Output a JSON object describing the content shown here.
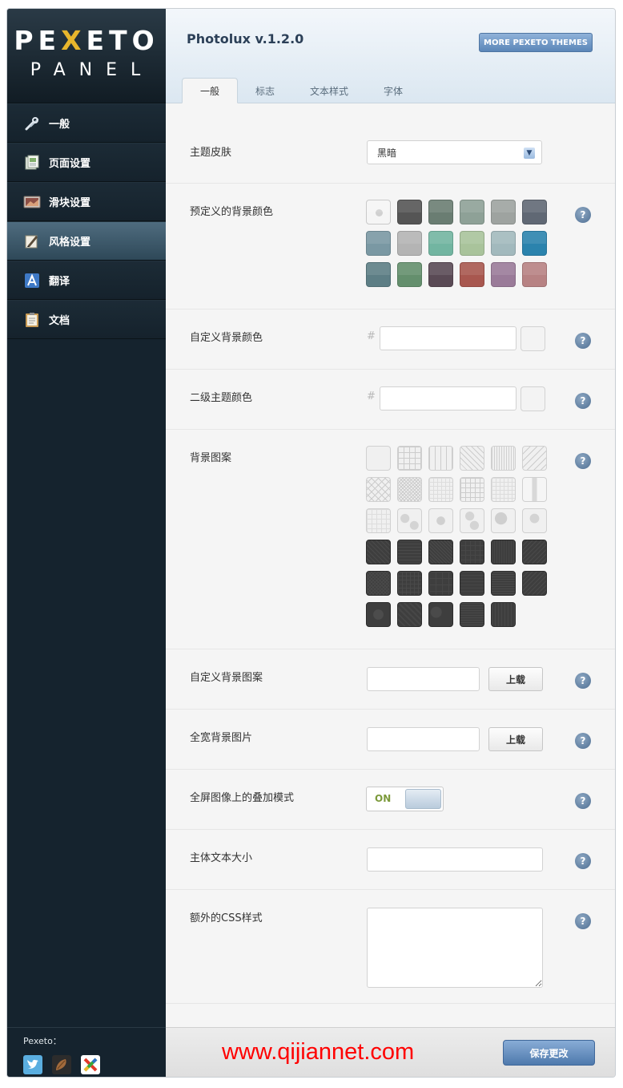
{
  "logo": {
    "word_part1": "PE",
    "word_x": "X",
    "word_part2": "ETO",
    "sub": "PANEL"
  },
  "sidebar": {
    "items": [
      {
        "label": "一般",
        "icon": "tools-icon"
      },
      {
        "label": "页面设置",
        "icon": "pages-icon"
      },
      {
        "label": "滑块设置",
        "icon": "slider-icon"
      },
      {
        "label": "风格设置",
        "icon": "style-icon",
        "active": true
      },
      {
        "label": "翻译",
        "icon": "translate-icon"
      },
      {
        "label": "文档",
        "icon": "document-icon"
      }
    ],
    "social_title": "Pexeto：",
    "social_icons": [
      "twitter-icon",
      "dribbble-icon",
      "pexeto-x-icon"
    ]
  },
  "header": {
    "title": "Photolux v.1.2.0",
    "themes_button": "MORE PEXETO THEMES",
    "tabs": [
      {
        "label": "一般",
        "active": true
      },
      {
        "label": "标志"
      },
      {
        "label": "文本样式"
      },
      {
        "label": "字体"
      }
    ]
  },
  "settings": {
    "theme_skin": {
      "label": "主题皮肤",
      "value": "黑暗"
    },
    "predefined_bg": {
      "label": "预定义的背景颜色",
      "colors": [
        "#f5f5f5",
        "#555555",
        "#6a7d72",
        "#8ea197",
        "#9ea3a0",
        "#606874",
        "#7a98a3",
        "#b4b4b4",
        "#72b5a1",
        "#a9c39b",
        "#a2b9bd",
        "#2b83ad",
        "#5d7e85",
        "#648f6d",
        "#5a4a55",
        "#a8574f",
        "#9a7b99",
        "#b78283"
      ],
      "selected_index": 0
    },
    "custom_bg_color": {
      "label": "自定义背景颜色",
      "hash": "#",
      "value": ""
    },
    "secondary_color": {
      "label": "二级主题颜色",
      "hash": "#",
      "value": ""
    },
    "bg_pattern": {
      "label": "背景图案",
      "light_count": 18,
      "dark_count": 17
    },
    "custom_bg_pattern": {
      "label": "自定义背景图案",
      "value": "",
      "button": "上载"
    },
    "full_bg_image": {
      "label": "全宽背景图片",
      "value": "",
      "button": "上载"
    },
    "overlay_mode": {
      "label": "全屏图像上的叠加模式",
      "state": "ON"
    },
    "body_font_size": {
      "label": "主体文本大小",
      "value": ""
    },
    "extra_css": {
      "label": "额外的CSS样式",
      "value": ""
    },
    "help_symbol": "?"
  },
  "footer": {
    "watermark": "www.qijiannet.com",
    "save_button": "保存更改"
  }
}
